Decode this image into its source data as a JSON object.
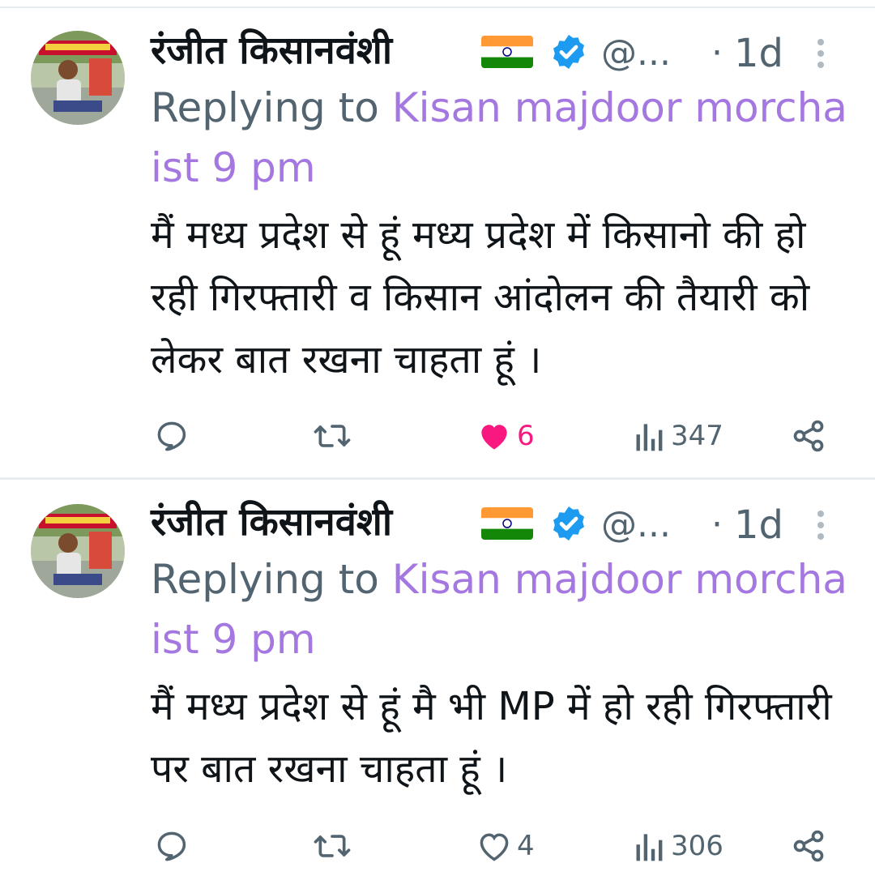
{
  "tweets": [
    {
      "author_name": "रंजीत किसानवंशी",
      "handle": "@...",
      "separator": "·",
      "time": "1d",
      "replying_prefix": "Replying to ",
      "replying_to": "Kisan majdoor morcha ist 9 pm",
      "text": "मैं मध्य प्रदेश से हूं मध्य प्रदेश में किसानो की हो रही गिरफ्तारी व किसान आंदोलन की तैयारी को लेकर बात रखना चाहता हूं ।",
      "likes": "6",
      "liked": true,
      "views": "347"
    },
    {
      "author_name": "रंजीत किसानवंशी",
      "handle": "@...",
      "separator": "·",
      "time": "1d",
      "replying_prefix": "Replying to ",
      "replying_to": "Kisan majdoor morcha ist 9 pm",
      "text": "मैं मध्य प्रदेश से हूं मै भी MP में हो रही गिरफ्तारी पर बात रखना चाहता हूं ।",
      "likes": "4",
      "liked": false,
      "views": "306"
    }
  ],
  "colors": {
    "link": "#a577e0",
    "secondary": "#536471",
    "like_active": "#f91880",
    "verified": "#1d9bf0"
  },
  "icons": [
    "reply-icon",
    "retweet-icon",
    "like-icon",
    "views-icon",
    "share-icon",
    "more-icon",
    "verified-badge-icon",
    "india-flag-icon"
  ]
}
